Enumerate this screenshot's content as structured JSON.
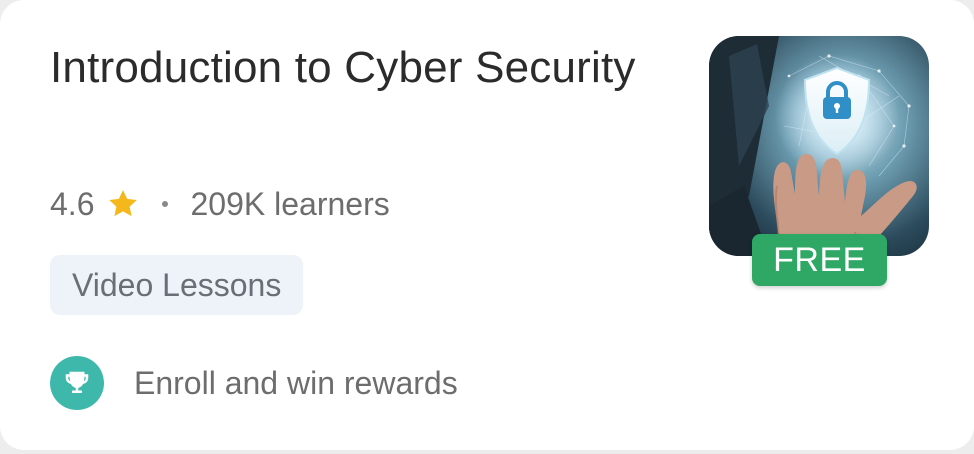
{
  "course": {
    "title": "Introduction to Cyber Security",
    "rating": "4.6",
    "learners": "209K learners",
    "format_tag": "Video Lessons",
    "reward_text": "Enroll and win rewards",
    "price_badge": "FREE"
  },
  "icons": {
    "rating": "star-icon",
    "reward": "trophy-icon",
    "thumbnail_lock": "padlock-shield-icon"
  },
  "colors": {
    "star": "#f5b81c",
    "trophy_badge": "#3fb8ac",
    "free_badge": "#2fa865",
    "chip_bg": "#eef3fa",
    "title_text": "#2b2b2b"
  }
}
